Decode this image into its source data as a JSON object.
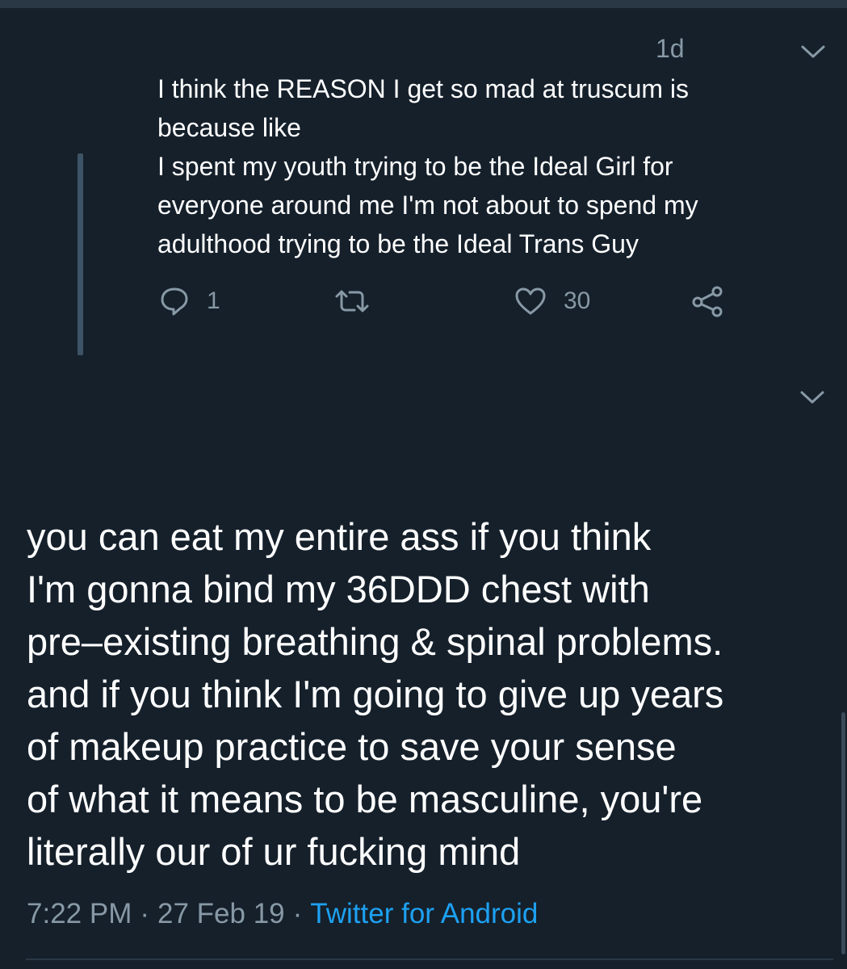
{
  "reply_tweet": {
    "time": "1d",
    "lines": [
      "I think the REASON I get so mad at truscum is",
      "because like",
      "I spent my youth trying to be the Ideal Girl for",
      "everyone around me I'm not about to spend my",
      "adulthood trying to be the Ideal Trans Guy"
    ],
    "reply_count": "1",
    "like_count": "30"
  },
  "main_tweet": {
    "lines": [
      "you can eat my entire ass if you think",
      "I'm gonna bind my 36DDD chest with",
      "pre–existing breathing & spinal problems.",
      "and if you think I'm going to give up years",
      "of makeup practice to save your sense",
      "of what it means to be masculine, you're",
      "literally our of ur fucking mind"
    ],
    "time": "7:22 PM",
    "date": "27 Feb 19",
    "separator": "·",
    "client": "Twitter for Android"
  },
  "icons": {
    "reply": "reply-icon",
    "retweet": "retweet-icon",
    "like": "heart-icon",
    "share": "share-icon",
    "menu": "chevron-down-icon"
  },
  "colors": {
    "background": "#15202b",
    "text": "#ffffff",
    "muted": "#8899a6",
    "link": "#1da1f2"
  }
}
